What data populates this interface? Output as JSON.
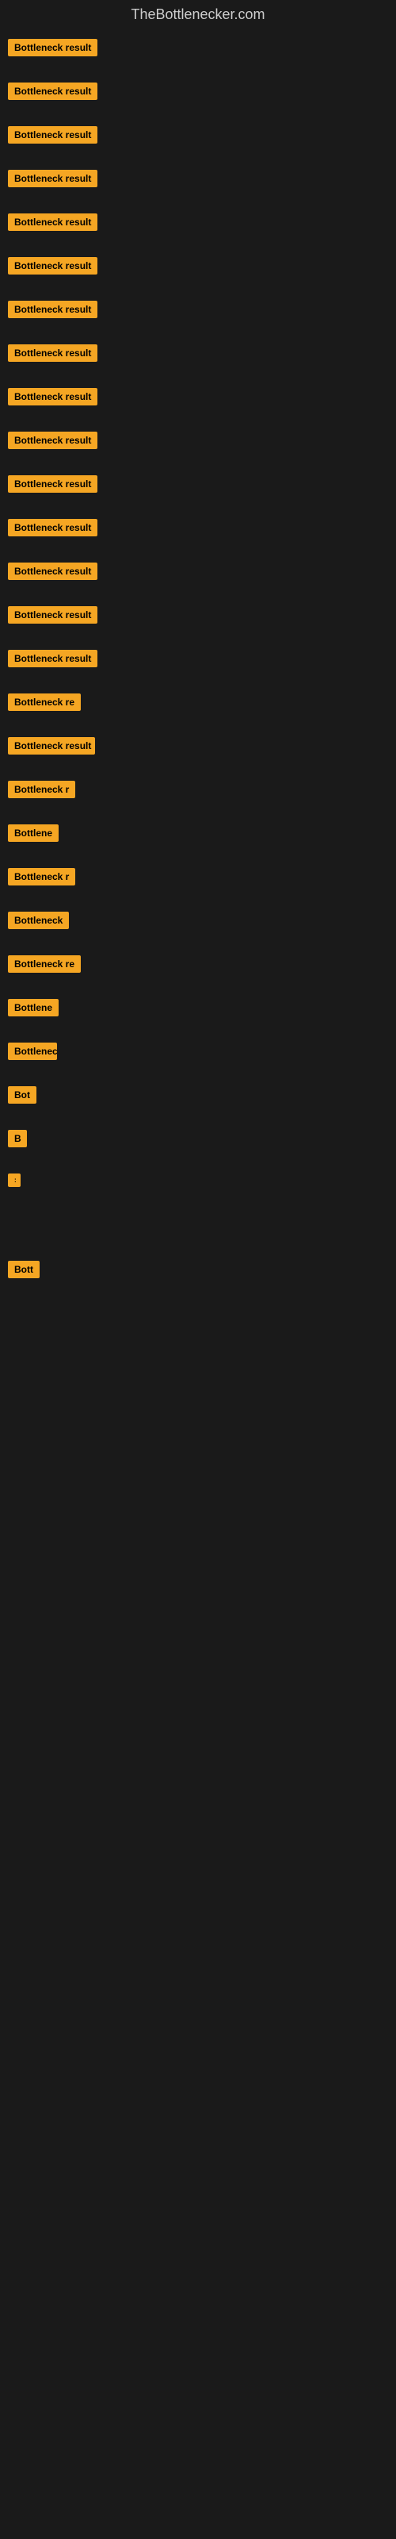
{
  "site": {
    "title": "TheBottlenecker.com"
  },
  "items": [
    {
      "label": "Bottleneck result",
      "visible": true
    },
    {
      "label": "Bottleneck result",
      "visible": true
    },
    {
      "label": "Bottleneck result",
      "visible": true
    },
    {
      "label": "Bottleneck result",
      "visible": true
    },
    {
      "label": "Bottleneck result",
      "visible": true
    },
    {
      "label": "Bottleneck result",
      "visible": true
    },
    {
      "label": "Bottleneck result",
      "visible": true
    },
    {
      "label": "Bottleneck result",
      "visible": true
    },
    {
      "label": "Bottleneck result",
      "visible": true
    },
    {
      "label": "Bottleneck result",
      "visible": true
    },
    {
      "label": "Bottleneck result",
      "visible": true
    },
    {
      "label": "Bottleneck result",
      "visible": true
    },
    {
      "label": "Bottleneck result",
      "visible": true
    },
    {
      "label": "Bottleneck result",
      "visible": true
    },
    {
      "label": "Bottleneck result",
      "visible": true
    },
    {
      "label": "Bottleneck re",
      "visible": true
    },
    {
      "label": "Bottleneck result",
      "visible": true
    },
    {
      "label": "Bottleneck r",
      "visible": true
    },
    {
      "label": "Bottlene",
      "visible": true
    },
    {
      "label": "Bottleneck r",
      "visible": true
    },
    {
      "label": "Bottleneck",
      "visible": true
    },
    {
      "label": "Bottleneck re",
      "visible": true
    },
    {
      "label": "Bottlene",
      "visible": true
    },
    {
      "label": "Bottleneck",
      "visible": true
    },
    {
      "label": "Bot",
      "visible": true
    },
    {
      "label": "B",
      "visible": true
    },
    {
      "label": ":",
      "visible": true
    },
    {
      "label": "Bott",
      "visible": true
    }
  ],
  "blank_sections": [
    {
      "height": 180
    },
    {
      "height": 120
    },
    {
      "height": 120
    }
  ]
}
